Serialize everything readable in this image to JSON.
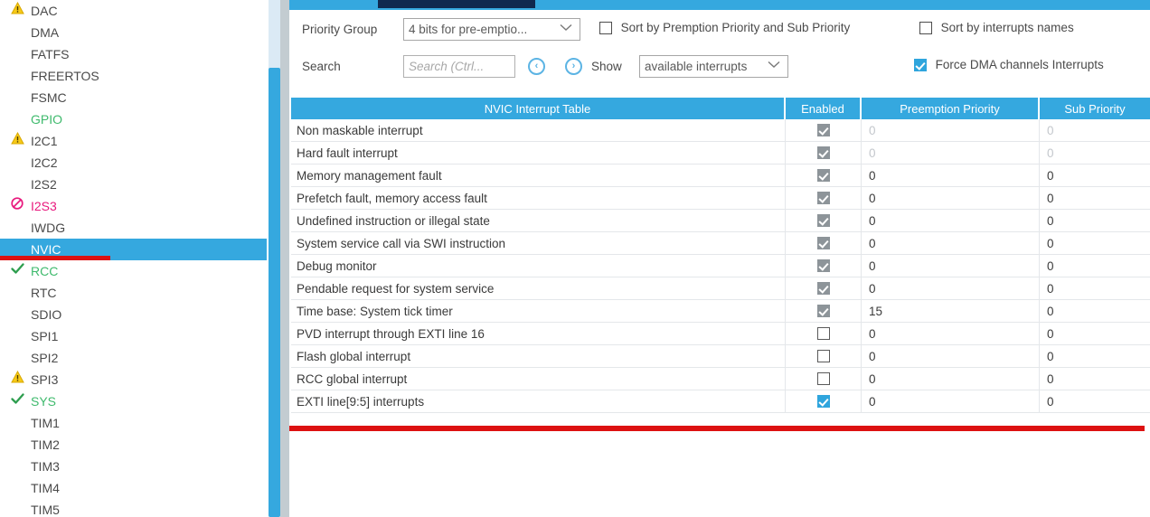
{
  "sidebar": {
    "items": [
      {
        "label": "DAC",
        "status": "warning",
        "icon": "warning-triangle-icon",
        "selected": false
      },
      {
        "label": "DMA",
        "status": "none",
        "icon": "",
        "selected": false
      },
      {
        "label": "FATFS",
        "status": "none",
        "icon": "",
        "selected": false
      },
      {
        "label": "FREERTOS",
        "status": "none",
        "icon": "",
        "selected": false
      },
      {
        "label": "FSMC",
        "status": "none",
        "icon": "",
        "selected": false
      },
      {
        "label": "GPIO",
        "status": "ok-text",
        "icon": "",
        "selected": false
      },
      {
        "label": "I2C1",
        "status": "warning",
        "icon": "warning-triangle-icon",
        "selected": false
      },
      {
        "label": "I2C2",
        "status": "none",
        "icon": "",
        "selected": false
      },
      {
        "label": "I2S2",
        "status": "none",
        "icon": "",
        "selected": false
      },
      {
        "label": "I2S3",
        "status": "error",
        "icon": "blocked-circle-icon",
        "selected": false
      },
      {
        "label": "IWDG",
        "status": "none",
        "icon": "",
        "selected": false
      },
      {
        "label": "NVIC",
        "status": "none",
        "icon": "",
        "selected": true
      },
      {
        "label": "RCC",
        "status": "ok",
        "icon": "check-icon",
        "selected": false
      },
      {
        "label": "RTC",
        "status": "none",
        "icon": "",
        "selected": false
      },
      {
        "label": "SDIO",
        "status": "none",
        "icon": "",
        "selected": false
      },
      {
        "label": "SPI1",
        "status": "none",
        "icon": "",
        "selected": false
      },
      {
        "label": "SPI2",
        "status": "none",
        "icon": "",
        "selected": false
      },
      {
        "label": "SPI3",
        "status": "warning",
        "icon": "warning-triangle-icon",
        "selected": false
      },
      {
        "label": "SYS",
        "status": "ok",
        "icon": "check-icon",
        "selected": false
      },
      {
        "label": "TIM1",
        "status": "none",
        "icon": "",
        "selected": false
      },
      {
        "label": "TIM2",
        "status": "none",
        "icon": "",
        "selected": false
      },
      {
        "label": "TIM3",
        "status": "none",
        "icon": "",
        "selected": false
      },
      {
        "label": "TIM4",
        "status": "none",
        "icon": "",
        "selected": false
      },
      {
        "label": "TIM5",
        "status": "none",
        "icon": "",
        "selected": false
      }
    ]
  },
  "toolbar": {
    "priority_group_label": "Priority Group",
    "priority_group_value": "4 bits for pre-emptio...",
    "sort_premption_label": "Sort by Premption Priority and Sub Priority",
    "sort_premption_checked": false,
    "sort_names_label": "Sort by interrupts names",
    "sort_names_checked": false,
    "search_label": "Search",
    "search_value": "",
    "search_placeholder": "Search (Ctrl...",
    "prev_icon": "circle-left-arrow-icon",
    "next_icon": "circle-right-arrow-icon",
    "prev_glyph": "‹",
    "next_glyph": "›",
    "show_label": "Show",
    "show_value": "available interrupts",
    "force_dma_label": "Force DMA channels Interrupts",
    "force_dma_checked": true,
    "chevron_glyph": "∨"
  },
  "table": {
    "headers": {
      "name": "NVIC Interrupt Table",
      "enabled": "Enabled",
      "preemption": "Preemption Priority",
      "sub": "Sub Priority"
    },
    "rows": [
      {
        "name": "Non maskable interrupt",
        "enabled": true,
        "enabled_style": "gray",
        "preemption": "0",
        "sub": "0",
        "dim": true
      },
      {
        "name": "Hard fault interrupt",
        "enabled": true,
        "enabled_style": "gray",
        "preemption": "0",
        "sub": "0",
        "dim": true
      },
      {
        "name": "Memory management fault",
        "enabled": true,
        "enabled_style": "gray",
        "preemption": "0",
        "sub": "0",
        "dim": false
      },
      {
        "name": "Prefetch fault, memory access fault",
        "enabled": true,
        "enabled_style": "gray",
        "preemption": "0",
        "sub": "0",
        "dim": false
      },
      {
        "name": "Undefined instruction or illegal state",
        "enabled": true,
        "enabled_style": "gray",
        "preemption": "0",
        "sub": "0",
        "dim": false
      },
      {
        "name": "System service call via SWI instruction",
        "enabled": true,
        "enabled_style": "gray",
        "preemption": "0",
        "sub": "0",
        "dim": false
      },
      {
        "name": "Debug monitor",
        "enabled": true,
        "enabled_style": "gray",
        "preemption": "0",
        "sub": "0",
        "dim": false
      },
      {
        "name": "Pendable request for system service",
        "enabled": true,
        "enabled_style": "gray",
        "preemption": "0",
        "sub": "0",
        "dim": false
      },
      {
        "name": "Time base: System tick timer",
        "enabled": true,
        "enabled_style": "gray",
        "preemption": "15",
        "sub": "0",
        "dim": false
      },
      {
        "name": "PVD interrupt through EXTI line 16",
        "enabled": false,
        "enabled_style": "none",
        "preemption": "0",
        "sub": "0",
        "dim": false
      },
      {
        "name": "Flash global interrupt",
        "enabled": false,
        "enabled_style": "none",
        "preemption": "0",
        "sub": "0",
        "dim": false
      },
      {
        "name": "RCC global interrupt",
        "enabled": false,
        "enabled_style": "none",
        "preemption": "0",
        "sub": "0",
        "dim": false
      },
      {
        "name": "EXTI line[9:5] interrupts",
        "enabled": true,
        "enabled_style": "blue",
        "preemption": "0",
        "sub": "0",
        "dim": false
      }
    ]
  },
  "colors": {
    "accent_blue": "#35a8df",
    "tab_navy": "#10294f",
    "warning_yellow": "#f5c518",
    "ok_green": "#3fba6d",
    "error_pink": "#e8197d",
    "annotation_red": "#dd1111",
    "checkbox_gray": "#8d9499"
  },
  "annotations": {
    "nvic_underline": "red-highlight-line",
    "table_bottom_line": "red-highlight-line"
  }
}
